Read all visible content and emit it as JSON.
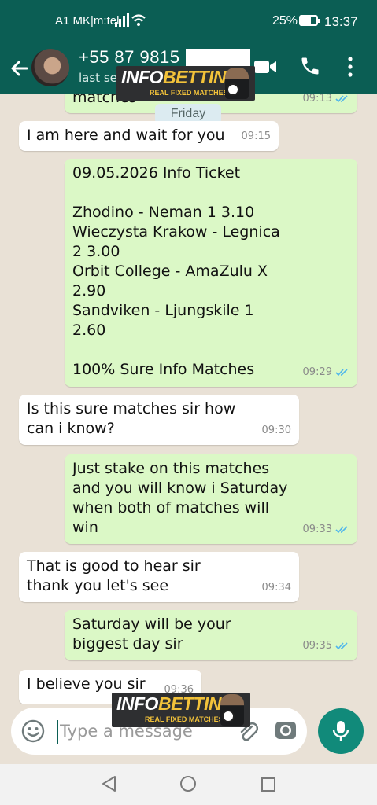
{
  "status_bar": {
    "carrier": "A1 MK|m:tel",
    "battery": "25%",
    "time": "13:37"
  },
  "header": {
    "contact_name": "+55 87 9815",
    "last_seen": "last se"
  },
  "watermark": {
    "title_a": "INFO",
    "title_b": "BETTING",
    "subtitle": "REAL FIXED MATCHES"
  },
  "day_separator": "Friday",
  "messages": [
    {
      "direction": "out",
      "text": "matches",
      "time": "09:13",
      "ticks": "read"
    },
    {
      "direction": "in",
      "text": "I am here and wait for you",
      "time": "09:15"
    },
    {
      "direction": "out",
      "text": "09.05.2026 Info Ticket\n\nZhodino - Neman  1  3.10\nWieczysta Krakow - Legnica\n2  3.00\nOrbit College - AmaZulu  X\n2.90\nSandviken - Ljungskile  1\n2.60\n\n100% Sure Info Matches",
      "time": "09:29",
      "ticks": "read"
    },
    {
      "direction": "in",
      "text": "Is this sure matches sir how\ncan i know?",
      "time": "09:30"
    },
    {
      "direction": "out",
      "text": "Just stake on this matches\nand you will know i Saturday\nwhen both of matches will\nwin",
      "time": "09:33",
      "ticks": "read"
    },
    {
      "direction": "in",
      "text": "That is good to hear sir\nthank you let's see",
      "time": "09:34"
    },
    {
      "direction": "out",
      "text": "Saturday will be your\nbiggest day sir",
      "time": "09:35",
      "ticks": "read"
    },
    {
      "direction": "in",
      "text": "I believe you sir",
      "time": "09:36"
    }
  ],
  "composer": {
    "placeholder": "Type a message"
  },
  "colors": {
    "header": "#0b5e54",
    "outgoing_bubble": "#dbf8c6",
    "incoming_bubble": "#ffffff",
    "read_ticks": "#4fb6ec",
    "mic_button": "#118a7a"
  },
  "icons": [
    "back-arrow-icon",
    "video-call-icon",
    "phone-icon",
    "more-vert-icon",
    "emoji-icon",
    "attach-icon",
    "camera-icon",
    "mic-icon"
  ]
}
